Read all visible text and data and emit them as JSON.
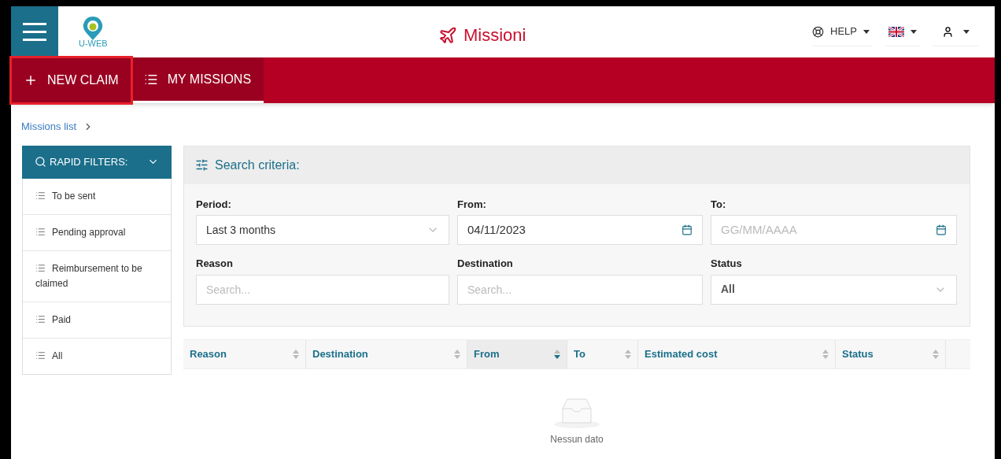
{
  "header": {
    "title": "Missioni",
    "logo_text": "U-WEB",
    "help": "HELP"
  },
  "nav_tabs": [
    {
      "label": "NEW CLAIM",
      "selected": false,
      "highlighted": true
    },
    {
      "label": "MY MISSIONS",
      "selected": true,
      "highlighted": false
    }
  ],
  "breadcrumb": "Missions list",
  "rapid_filters": {
    "title": "RAPID FILTERS:",
    "items": [
      "To be sent",
      "Pending approval",
      "Reimbursement to be claimed",
      "Paid",
      "All"
    ]
  },
  "search_criteria": {
    "title": "Search criteria:",
    "fields": [
      {
        "label": "Period:",
        "kind": "select",
        "value": "Last 3 months"
      },
      {
        "label": "From:",
        "kind": "date",
        "value": "04/11/2023"
      },
      {
        "label": "To:",
        "kind": "date",
        "placeholder": "GG/MM/AAAA"
      },
      {
        "label": "Reason",
        "kind": "text",
        "placeholder": "Search..."
      },
      {
        "label": "Destination",
        "kind": "text",
        "placeholder": "Search..."
      },
      {
        "label": "Status",
        "kind": "select",
        "value": "All"
      }
    ]
  },
  "table": {
    "columns": [
      {
        "label": "Reason",
        "sorted": false
      },
      {
        "label": "Destination",
        "sorted": false
      },
      {
        "label": "From",
        "sorted": true
      },
      {
        "label": "To",
        "sorted": false
      },
      {
        "label": "Estimated cost",
        "sorted": false
      },
      {
        "label": "Status",
        "sorted": false
      }
    ],
    "empty_text": "Nessun dato"
  }
}
